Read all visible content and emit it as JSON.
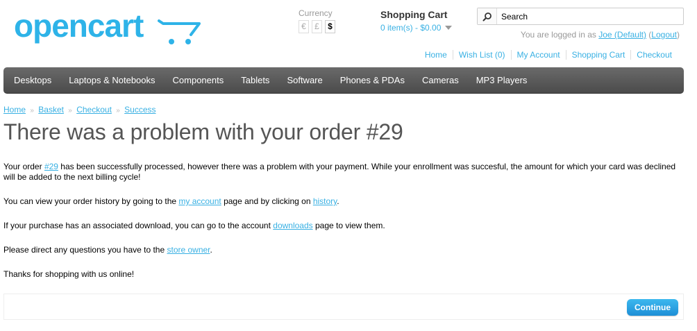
{
  "header": {
    "logo_text": "opencart",
    "currency": {
      "label": "Currency",
      "options": [
        "€",
        "£",
        "$"
      ],
      "selected": "$"
    },
    "cart": {
      "heading": "Shopping Cart",
      "total": "0 item(s) - $0.00"
    },
    "search": {
      "placeholder": "Search",
      "value": "Search"
    },
    "welcome": {
      "prefix": "You are logged in as",
      "user": "Joe (Default)",
      "open_paren": "(",
      "logout": "Logout",
      "close_paren": ")"
    },
    "links": [
      "Home",
      "Wish List (0)",
      "My Account",
      "Shopping Cart",
      "Checkout"
    ]
  },
  "menu": [
    "Desktops",
    "Laptops & Notebooks",
    "Components",
    "Tablets",
    "Software",
    "Phones & PDAs",
    "Cameras",
    "MP3 Players"
  ],
  "breadcrumb": [
    "Home",
    "Basket",
    "Checkout",
    "Success"
  ],
  "breadcrumb_separator": "»",
  "page": {
    "title": "There was a problem with your order #29",
    "p1": {
      "a": "Your order ",
      "order_link": "#29",
      "b": " has been successfully processed, however there was a problem with your payment. While your enrollment was succesful, the amount for which your card was declined will be added to the next billing cycle!"
    },
    "p2": {
      "a": "You can view your order history by going to the ",
      "account_link": "my account",
      "b": " page and by clicking on ",
      "history_link": "history",
      "c": "."
    },
    "p3": {
      "a": "If your purchase has an associated download, you can go to the account ",
      "downloads_link": "downloads",
      "b": " page to view them."
    },
    "p4": {
      "a": "Please direct any questions you have to the ",
      "owner_link": "store owner",
      "b": "."
    },
    "p5": "Thanks for shopping with us online!",
    "continue_label": "Continue"
  },
  "colors": {
    "brand": "#2eb3e8",
    "link": "#38B0E3",
    "menu_bg": "#555555",
    "button": "#1e9ae0"
  }
}
